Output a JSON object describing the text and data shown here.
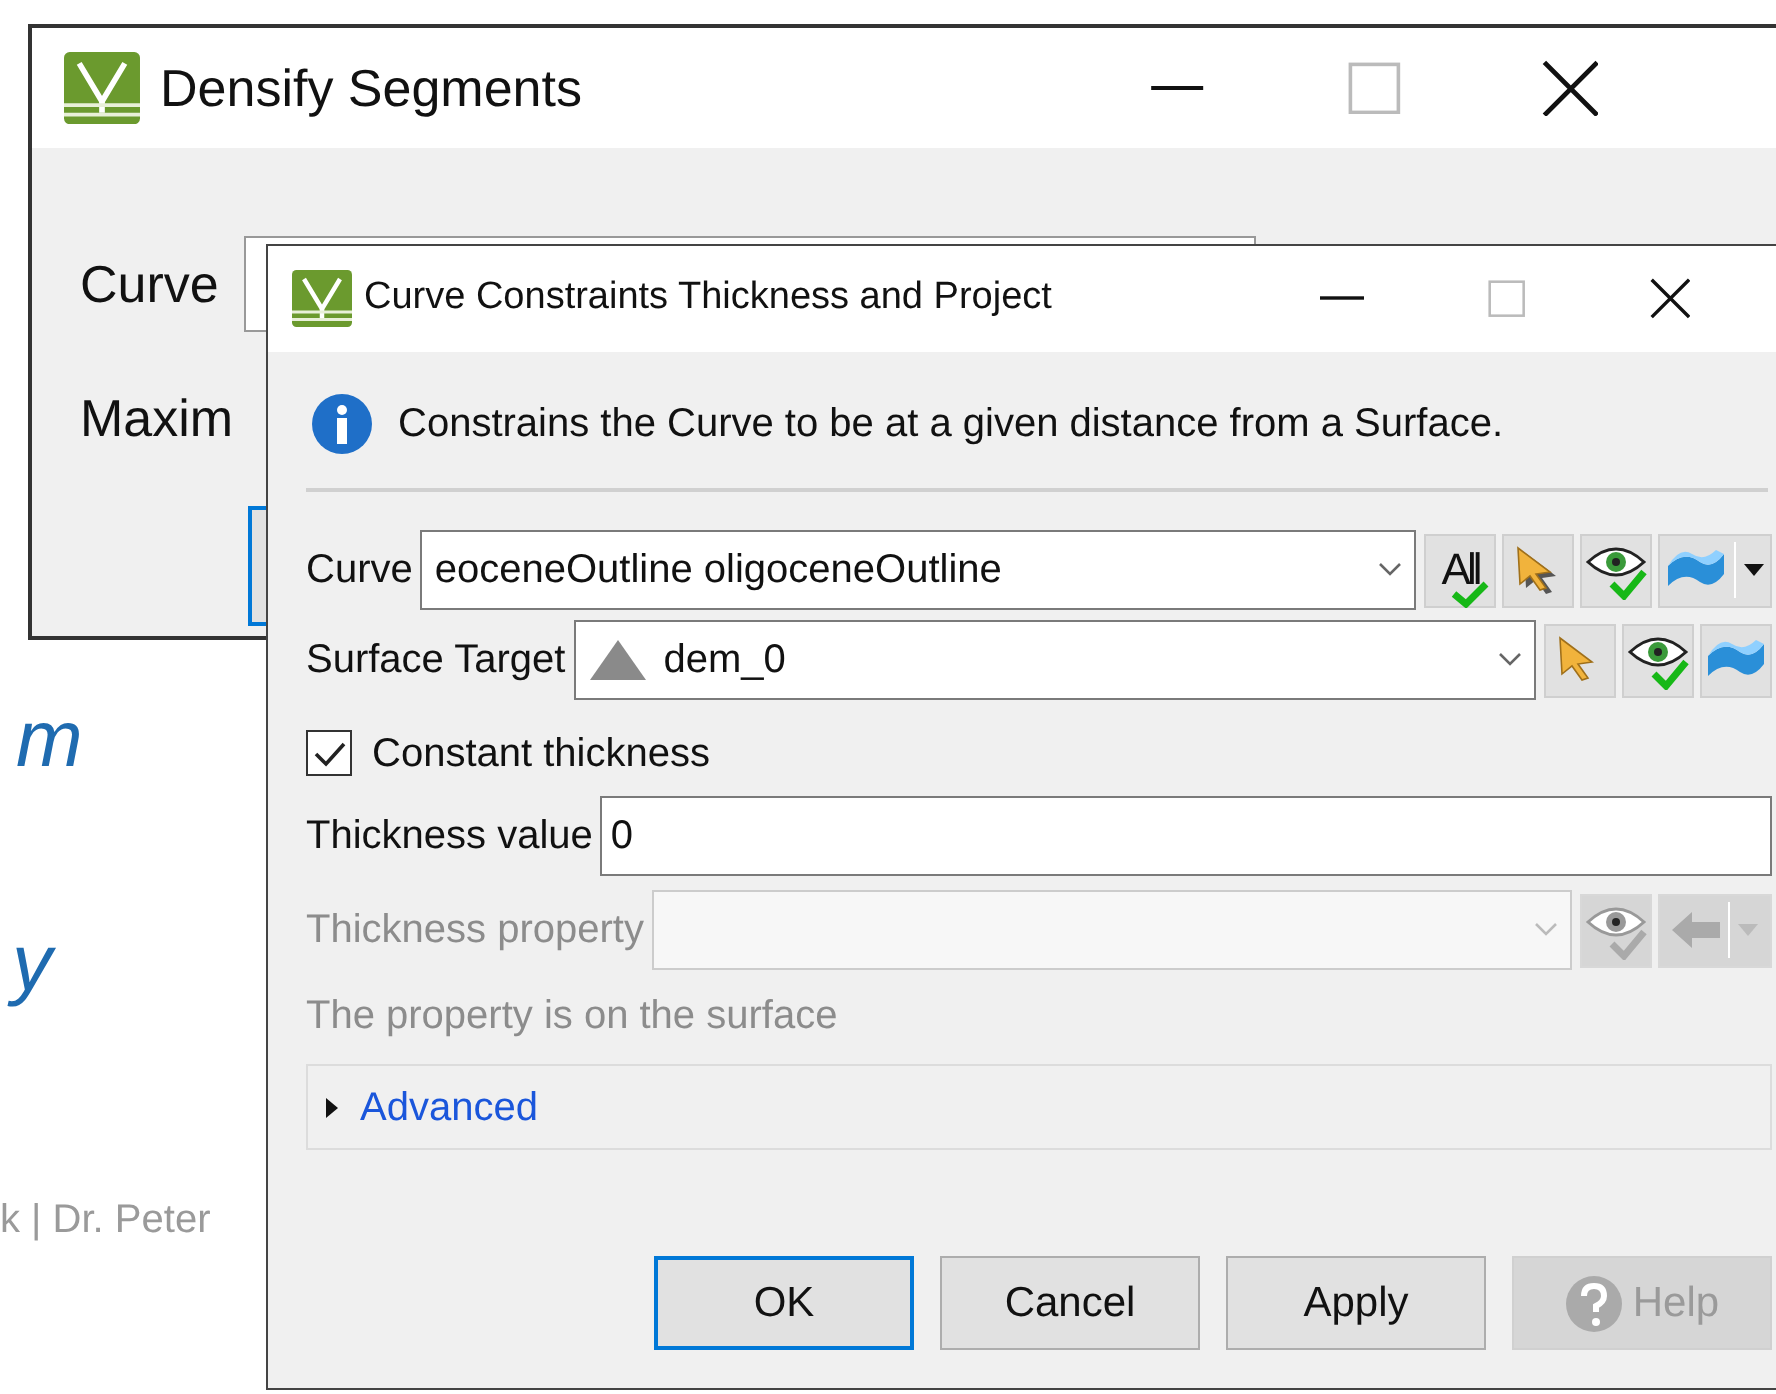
{
  "background_text": [
    {
      "text": "m",
      "kind": "italic"
    },
    {
      "text": "y",
      "kind": "italic"
    },
    {
      "text": "k | Dr. Peter",
      "kind": "footer"
    }
  ],
  "back_window": {
    "title": "Densify Segments",
    "labels": [
      "Curve",
      "Maxim"
    ]
  },
  "dialog": {
    "title": "Curve Constraints Thickness and Project",
    "info": "Constrains the Curve to be at a given distance from a Surface.",
    "curve": {
      "label": "Curve",
      "value": "eoceneOutline oligoceneOutline",
      "all_button": "All"
    },
    "surface_target": {
      "label": "Surface Target",
      "value": "dem_0"
    },
    "constant_thickness": {
      "label": "Constant thickness",
      "checked": true
    },
    "thickness_value": {
      "label": "Thickness value",
      "value": "0"
    },
    "thickness_property": {
      "label": "Thickness property",
      "disabled": true
    },
    "note": "The property is on the surface",
    "advanced": {
      "label": "Advanced",
      "expanded": false
    },
    "buttons": [
      {
        "label": "OK",
        "kind": "default",
        "disabled": false
      },
      {
        "label": "Cancel",
        "kind": "plain",
        "disabled": false
      },
      {
        "label": "Apply",
        "kind": "plain",
        "disabled": false
      },
      {
        "label": "Help",
        "kind": "help",
        "disabled": true
      }
    ]
  }
}
